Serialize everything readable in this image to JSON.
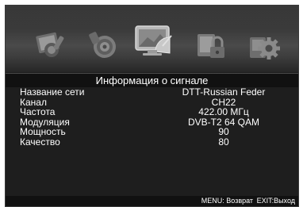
{
  "menu_icons": [
    {
      "name": "picture-settings-icon",
      "selected": false
    },
    {
      "name": "sound-settings-icon",
      "selected": false
    },
    {
      "name": "channel-settings-icon",
      "selected": true
    },
    {
      "name": "lock-settings-icon",
      "selected": false
    },
    {
      "name": "system-settings-icon",
      "selected": false
    }
  ],
  "header": {
    "title": "Информация о сигнале"
  },
  "signal_info": [
    {
      "label": "Название сети",
      "value": "DTT-Russian Feder"
    },
    {
      "label": "Канал",
      "value": "CH22"
    },
    {
      "label": "Частота",
      "value": "422.00 МГц"
    },
    {
      "label": "Модуляция",
      "value": "DVB-T2 64 QAM"
    },
    {
      "label": "Мощность",
      "value": "90"
    },
    {
      "label": "Качество",
      "value": "80"
    }
  ],
  "footer": {
    "menu_hint": "MENU: Возврат",
    "exit_hint": "EXIT:Выход"
  }
}
